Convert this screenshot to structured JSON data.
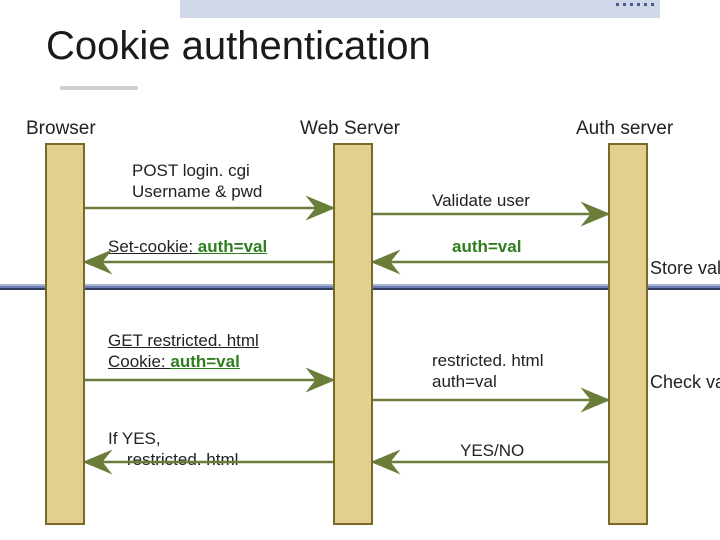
{
  "title": "Cookie authentication",
  "lanes": {
    "browser": "Browser",
    "web": "Web Server",
    "auth": "Auth server"
  },
  "messages": {
    "m1_line1": "POST login. cgi",
    "m1_line2": "Username & pwd",
    "m2": "Validate user",
    "m3_prefix": "Set-cookie: ",
    "m3_val": "auth=val",
    "m4": "auth=val",
    "m5_line1": "GET restricted. html",
    "m5_line2_prefix": "Cookie: ",
    "m5_line2_val": "auth=val",
    "m6_line1": "restricted. html",
    "m6_line2": "auth=val",
    "m7_line1": "If YES,",
    "m7_line2": "restricted. html",
    "m8": "YES/NO"
  },
  "notes": {
    "store": "Store val",
    "check": "Check val"
  },
  "colors": {
    "lane_fill": "#e3cf8e",
    "lane_border": "#7a6a2a",
    "arrow": "#6b7d3a",
    "emph": "#2e7d1f"
  }
}
